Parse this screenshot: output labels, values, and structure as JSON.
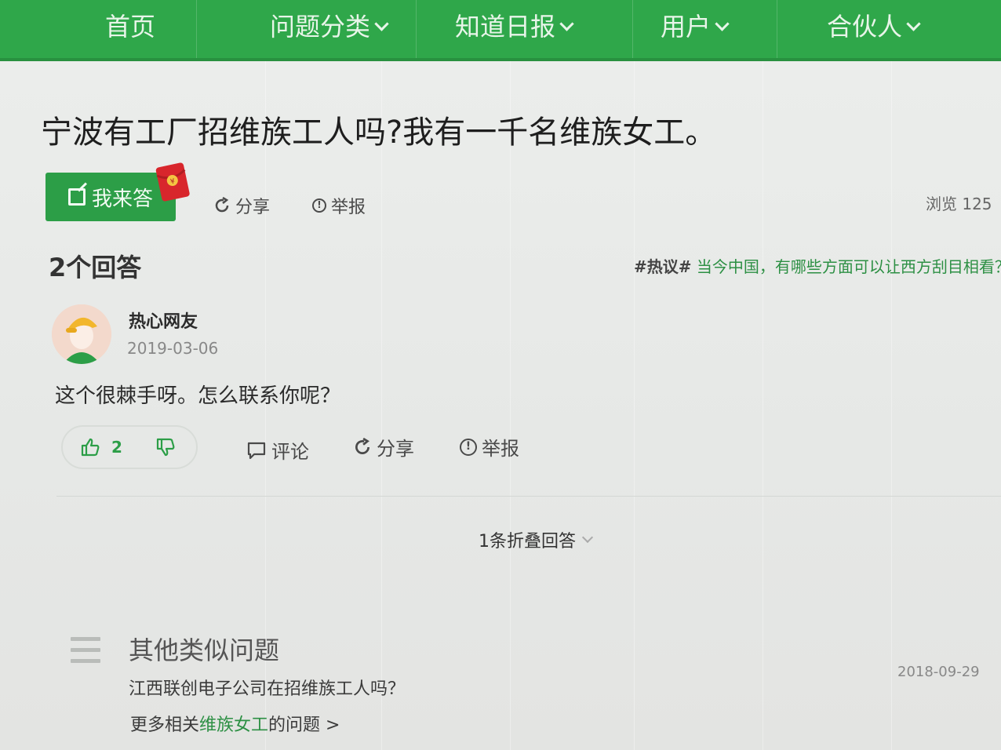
{
  "nav": {
    "items": [
      {
        "label": "首页",
        "has_dropdown": false
      },
      {
        "label": "问题分类",
        "has_dropdown": true
      },
      {
        "label": "知道日报",
        "has_dropdown": true
      },
      {
        "label": "用户",
        "has_dropdown": true
      },
      {
        "label": "合伙人",
        "has_dropdown": true
      }
    ],
    "bg_color": "#2fa74a"
  },
  "question": {
    "title": "宁波有工厂招维族工人吗?我有一千名维族女工。",
    "answer_button_label": "我来答",
    "share_label": "分享",
    "report_label": "举报",
    "views_text": "浏览 125"
  },
  "answers_header": {
    "count_label": "2个回答",
    "hot_tag": "#热议#",
    "hot_topic": "当今中国，有哪些方面可以让西方刮目相看？"
  },
  "answer": {
    "author": "热心网友",
    "date": "2019-03-06",
    "text": "这个很棘手呀。怎么联系你呢？",
    "upvotes": "2",
    "comment_label": "评论",
    "share_label": "分享",
    "report_label": "举报"
  },
  "folded": {
    "label": "1条折叠回答"
  },
  "similar": {
    "title": "其他类似问题",
    "question": "江西联创电子公司在招维族工人吗？",
    "date": "2018-09-29",
    "more_prefix": "更多相关",
    "more_keyword": "维族女工",
    "more_suffix": "的问题 >"
  },
  "accent_color": "#2c9e47"
}
